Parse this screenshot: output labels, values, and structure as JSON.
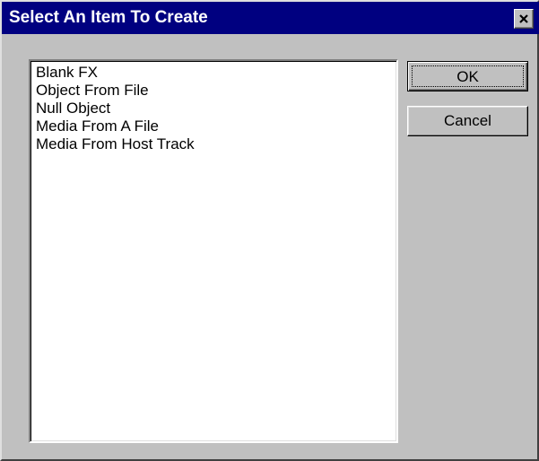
{
  "window": {
    "title": "Select An Item To Create"
  },
  "titlebar": {
    "close_icon": "close-x-icon"
  },
  "list": {
    "items": [
      "Blank FX",
      "Object From File",
      "Null Object",
      "Media From A File",
      "Media From Host Track"
    ]
  },
  "buttons": {
    "ok_label": "OK",
    "cancel_label": "Cancel"
  },
  "colors": {
    "titlebar": "#000080",
    "face": "#c0c0c0"
  }
}
